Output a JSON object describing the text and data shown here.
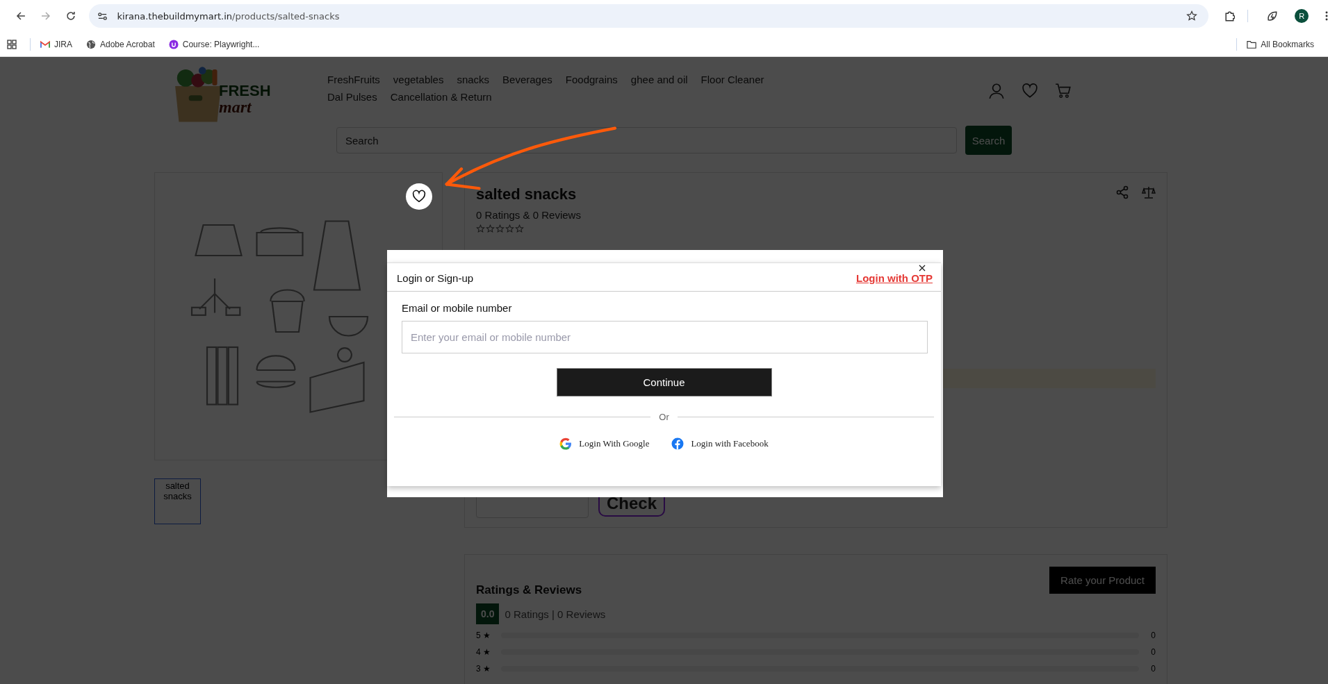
{
  "browser": {
    "url_host": "kirana.thebuildmymart.in",
    "url_path": "/products/salted-snacks",
    "bookmarks": [
      {
        "kind": "gmail",
        "label": "JIRA"
      },
      {
        "kind": "globe",
        "label": "Adobe Acrobat"
      },
      {
        "kind": "course",
        "label": "Course: Playwright..."
      }
    ],
    "all_bookmarks": "All Bookmarks",
    "profile_initial": "R"
  },
  "header": {
    "logo": {
      "line1": "FRESH",
      "line2": "mart"
    },
    "nav": [
      "FreshFruits",
      "vegetables",
      "snacks",
      "Beverages",
      "Foodgrains",
      "ghee and oil",
      "Floor Cleaner",
      "Dal Pulses",
      "Cancellation & Return"
    ],
    "search": {
      "placeholder": "Search",
      "button": "Search"
    }
  },
  "product": {
    "title": "salted snacks",
    "ratings_summary": "0 Ratings & 0 Reviews",
    "stars": 0,
    "thumbnail_alt": "salted snacks",
    "check_button": "Check"
  },
  "reviews": {
    "title": "Ratings & Reviews",
    "rate_button": "Rate your Product",
    "score": "0.0",
    "summary": "0 Ratings | 0 Reviews",
    "rows": [
      {
        "label": "5 ★",
        "level": 0,
        "count": "0"
      },
      {
        "label": "4 ★",
        "level": 0,
        "count": "0"
      },
      {
        "label": "3 ★",
        "level": 0,
        "count": "0"
      }
    ]
  },
  "modal": {
    "title": "Login or Sign-up",
    "otp_link": "Login with OTP",
    "field_label": "Email or mobile number",
    "placeholder": "Enter your email or mobile number",
    "continue": "Continue",
    "divider": "Or",
    "social": [
      {
        "kind": "google",
        "label": "Login With Google"
      },
      {
        "kind": "facebook",
        "label": "Login with Facebook"
      }
    ]
  }
}
